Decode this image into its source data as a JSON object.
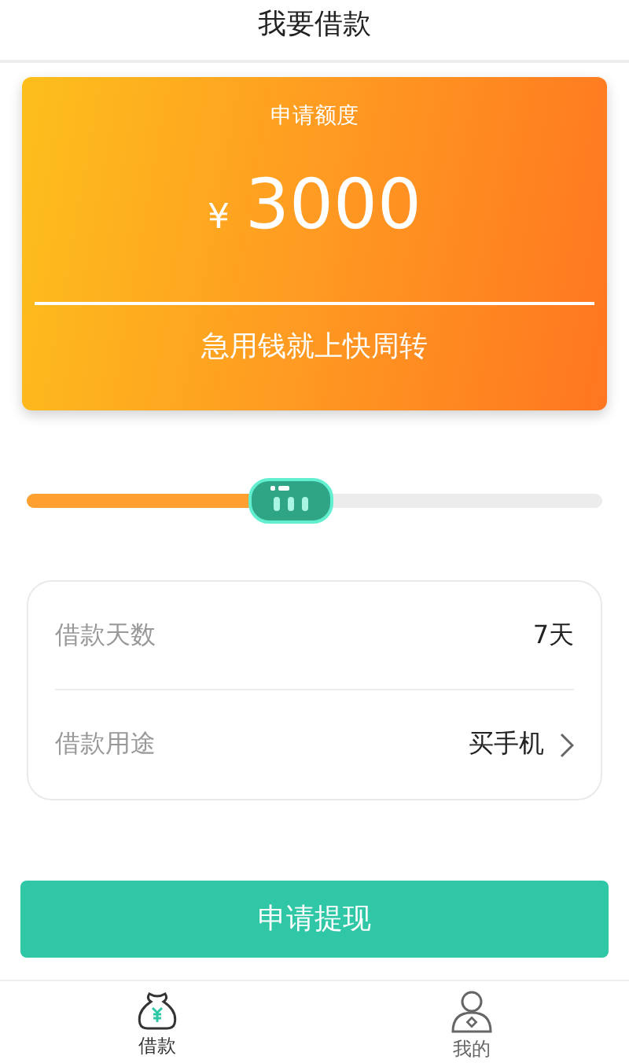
{
  "header": {
    "title": "我要借款"
  },
  "amount_card": {
    "label": "申请额度",
    "currency": "¥",
    "amount": "3000",
    "slogan": "急用钱就上快周转"
  },
  "slider": {
    "level": 0.46
  },
  "details": [
    {
      "label": "借款天数",
      "value": "7天",
      "kind": "plain"
    },
    {
      "label": "借款用途",
      "value": "买手机",
      "kind": "select"
    }
  ],
  "submit_button": "申请提现",
  "tabs": [
    {
      "label": "借款",
      "kind": "loan",
      "selected": true
    },
    {
      "label": "我的",
      "kind": "profile",
      "selected": false
    }
  ]
}
